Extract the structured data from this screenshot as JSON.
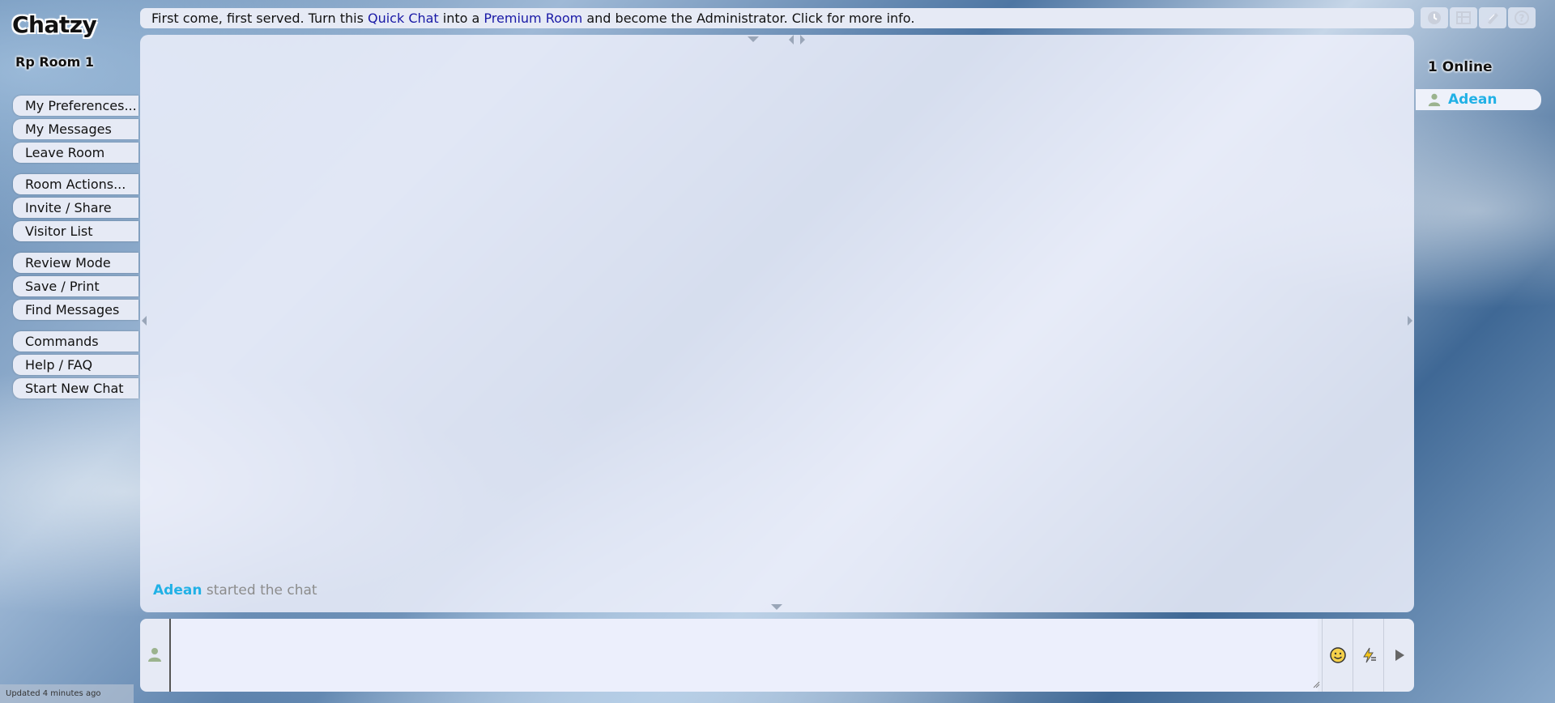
{
  "app": {
    "logo": "Chatzy",
    "room_title": "Rp Room 1"
  },
  "menu": {
    "groups": [
      [
        {
          "label": "My Preferences..."
        },
        {
          "label": "My Messages"
        },
        {
          "label": "Leave Room"
        }
      ],
      [
        {
          "label": "Room Actions..."
        },
        {
          "label": "Invite / Share"
        },
        {
          "label": "Visitor List"
        }
      ],
      [
        {
          "label": "Review Mode"
        },
        {
          "label": "Save / Print"
        },
        {
          "label": "Find Messages"
        }
      ],
      [
        {
          "label": "Commands"
        },
        {
          "label": "Help / FAQ"
        },
        {
          "label": "Start New Chat"
        }
      ]
    ]
  },
  "banner": {
    "part1": "First come, first served. Turn this ",
    "link1": "Quick Chat",
    "part2": " into a ",
    "link2": "Premium Room",
    "part3": " and become the Administrator. Click for more info."
  },
  "top_icons": [
    "clock-icon",
    "layout-icon",
    "pencil-icon",
    "help-icon"
  ],
  "chat": {
    "messages": [
      {
        "user": "Adean",
        "text": " started the chat"
      }
    ]
  },
  "online": {
    "title": "1 Online",
    "users": [
      {
        "name": "Adean"
      }
    ]
  },
  "input": {
    "placeholder": ""
  },
  "footer": {
    "status": "Updated 4 minutes ago"
  },
  "colors": {
    "username": "#21b1e6",
    "link": "#1a1aa6",
    "panel": "#e6eaf5"
  }
}
